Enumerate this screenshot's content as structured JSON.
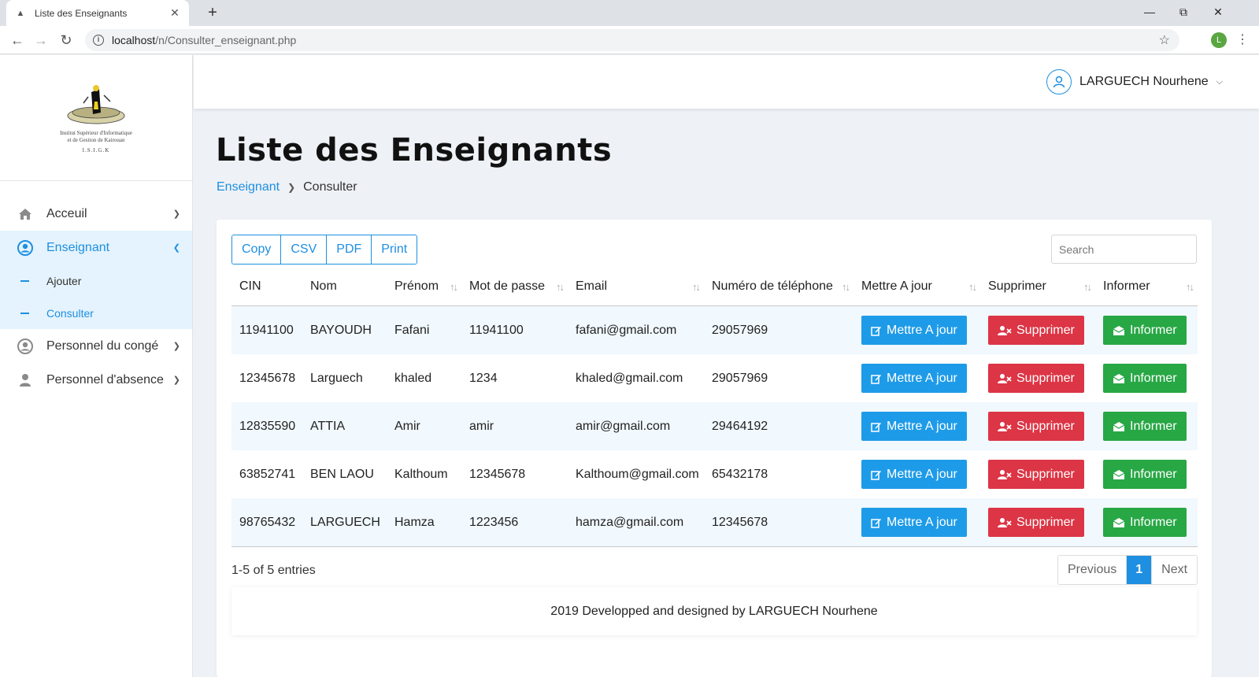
{
  "browser": {
    "tab_title": "Liste des Enseignants",
    "url_host": "localhost",
    "url_path": "/n/Consulter_enseignant.php",
    "profile_initial": "L"
  },
  "logo": {
    "line1": "Institut Supérieur d'Informatique",
    "line2": "et de Gestion de Kairouan",
    "line3": "I.S.I.G.K"
  },
  "sidebar": {
    "items": [
      {
        "label": "Acceuil",
        "icon": "home-icon"
      },
      {
        "label": "Enseignant",
        "icon": "user-circle-icon"
      },
      {
        "label": "Personnel du congé",
        "icon": "user-circle-icon"
      },
      {
        "label": "Personnel d'absence",
        "icon": "user-icon"
      }
    ],
    "submenu": [
      {
        "label": "Ajouter"
      },
      {
        "label": "Consulter"
      }
    ]
  },
  "header": {
    "user_name": "LARGUECH Nourhene"
  },
  "page": {
    "title": "Liste des Enseignants",
    "breadcrumb_parent": "Enseignant",
    "breadcrumb_current": "Consulter"
  },
  "toolbar": {
    "copy": "Copy",
    "csv": "CSV",
    "pdf": "PDF",
    "print": "Print",
    "search_placeholder": "Search"
  },
  "table": {
    "columns": [
      "CIN",
      "Nom",
      "Prénom",
      "Mot de passe",
      "Email",
      "Numéro de téléphone",
      "Mettre A jour",
      "Supprimer",
      "Informer"
    ],
    "rows": [
      {
        "cin": "11941100",
        "nom": "BAYOUDH",
        "prenom": "Fafani",
        "mdp": "11941100",
        "email": "fafani@gmail.com",
        "tel": "29057969"
      },
      {
        "cin": "12345678",
        "nom": "Larguech",
        "prenom": "khaled",
        "mdp": "1234",
        "email": "khaled@gmail.com",
        "tel": "29057969"
      },
      {
        "cin": "12835590",
        "nom": "ATTIA",
        "prenom": "Amir",
        "mdp": "amir",
        "email": "amir@gmail.com",
        "tel": "29464192"
      },
      {
        "cin": "63852741",
        "nom": "BEN LAOU",
        "prenom": "Kalthoum",
        "mdp": "12345678",
        "email": "Kalthoum@gmail.com",
        "tel": "65432178"
      },
      {
        "cin": "98765432",
        "nom": "LARGUECH",
        "prenom": "Hamza",
        "mdp": "1223456",
        "email": "hamza@gmail.com",
        "tel": "12345678"
      }
    ],
    "actions": {
      "update": "Mettre A jour",
      "delete": "Supprimer",
      "inform": "Informer"
    }
  },
  "pagination": {
    "info": "1-5 of 5 entries",
    "previous": "Previous",
    "current": "1",
    "next": "Next"
  },
  "footer": {
    "text": "2019 Developped and designed by LARGUECH Nourhene"
  },
  "colors": {
    "primary": "#1e8fe1",
    "update": "#1e9be8",
    "delete": "#dc3545",
    "inform": "#28a745"
  }
}
